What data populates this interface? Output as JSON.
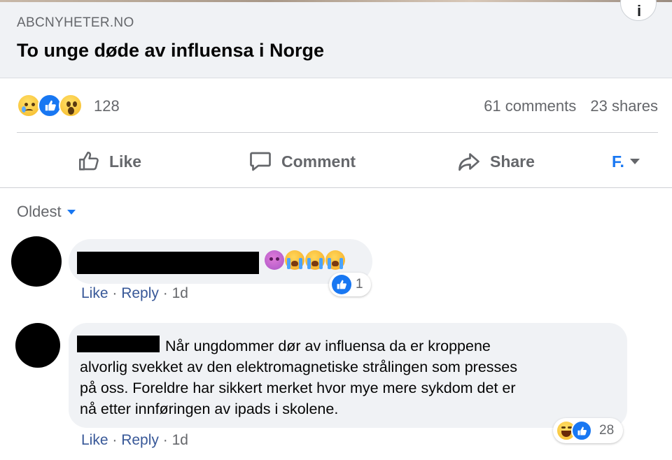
{
  "link_preview": {
    "domain": "ABCNYHETER.NO",
    "headline": "To unge døde av influensa i Norge",
    "info_glyph": "i"
  },
  "stats": {
    "reactions": [
      "sad-reaction-icon",
      "like-reaction-icon",
      "wow-reaction-icon"
    ],
    "reaction_count": "128",
    "comments": "61 comments",
    "shares": "23 shares"
  },
  "actions": {
    "like": "Like",
    "comment": "Comment",
    "share": "Share",
    "page_initial": "F."
  },
  "sort": {
    "label": "Oldest"
  },
  "comments": [
    {
      "author": "[redacted]",
      "emojis": [
        "purple-face-icon",
        "crying-face-icon",
        "crying-face-icon",
        "crying-face-icon"
      ],
      "reaction_count": "1",
      "like": "Like",
      "reply": "Reply",
      "time": "1d"
    },
    {
      "author": "[redacted]",
      "lines": [
        "Når ungdommer dør av influensa da er kroppene",
        "alvorlig svekket av den elektromagnetiske strålingen som presses",
        "på oss. Foreldre har sikkert merket hvor mye mere sykdom det er",
        "nå etter innføringen av ipads i skolene."
      ],
      "reaction_count": "28",
      "like": "Like",
      "reply": "Reply",
      "time": "1d"
    }
  ],
  "separator": " · ",
  "colors": {
    "brand": "#1877f2",
    "secondary_text": "#65676b",
    "bubble": "#f0f2f5"
  }
}
